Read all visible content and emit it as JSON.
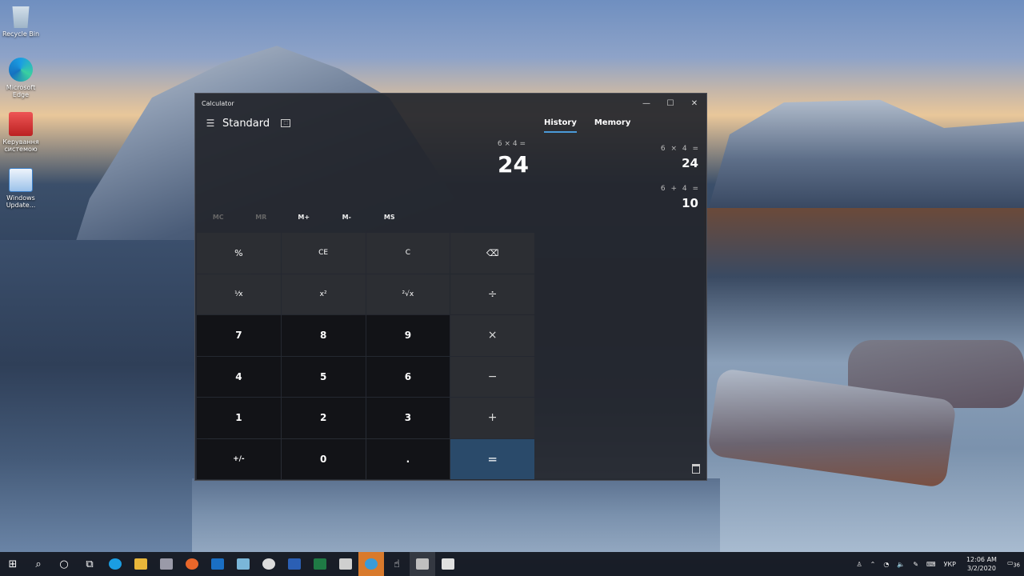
{
  "desktop": {
    "icons": [
      {
        "label": "Recycle Bin"
      },
      {
        "label": "Microsoft Edge"
      },
      {
        "label": "Керування системою"
      },
      {
        "label": "Windows Update..."
      }
    ]
  },
  "window": {
    "title": "Calculator",
    "controls": {
      "minimize": "—",
      "maximize": "☐",
      "close": "✕"
    }
  },
  "calc": {
    "mode": "Standard",
    "expression": "6 × 4 =",
    "result": "24",
    "memory": [
      "MC",
      "MR",
      "M+",
      "M-",
      "MS"
    ],
    "keys": [
      {
        "label": "%",
        "kind": "fn"
      },
      {
        "label": "CE",
        "kind": "fn"
      },
      {
        "label": "C",
        "kind": "fn"
      },
      {
        "label": "⌫",
        "kind": "fn"
      },
      {
        "label": "⅟x",
        "kind": "fn"
      },
      {
        "label": "x²",
        "kind": "fn"
      },
      {
        "label": "²√x",
        "kind": "fn"
      },
      {
        "label": "÷",
        "kind": "op"
      },
      {
        "label": "7",
        "kind": "num"
      },
      {
        "label": "8",
        "kind": "num"
      },
      {
        "label": "9",
        "kind": "num"
      },
      {
        "label": "×",
        "kind": "op"
      },
      {
        "label": "4",
        "kind": "num"
      },
      {
        "label": "5",
        "kind": "num"
      },
      {
        "label": "6",
        "kind": "num"
      },
      {
        "label": "−",
        "kind": "op"
      },
      {
        "label": "1",
        "kind": "num"
      },
      {
        "label": "2",
        "kind": "num"
      },
      {
        "label": "3",
        "kind": "num"
      },
      {
        "label": "+",
        "kind": "op"
      },
      {
        "label": "+/-",
        "kind": "num"
      },
      {
        "label": "0",
        "kind": "num"
      },
      {
        "label": ".",
        "kind": "num"
      },
      {
        "label": "=",
        "kind": "eq"
      }
    ]
  },
  "side": {
    "tabs": [
      "History",
      "Memory"
    ],
    "history": [
      {
        "expr": "6 × 4 =",
        "result": "24"
      },
      {
        "expr": "6 + 4 =",
        "result": "10"
      }
    ]
  },
  "taskbar": {
    "tray_lang": "УКР",
    "time": "12:06 AM",
    "date": "3/2/2020",
    "notifications": "36"
  }
}
